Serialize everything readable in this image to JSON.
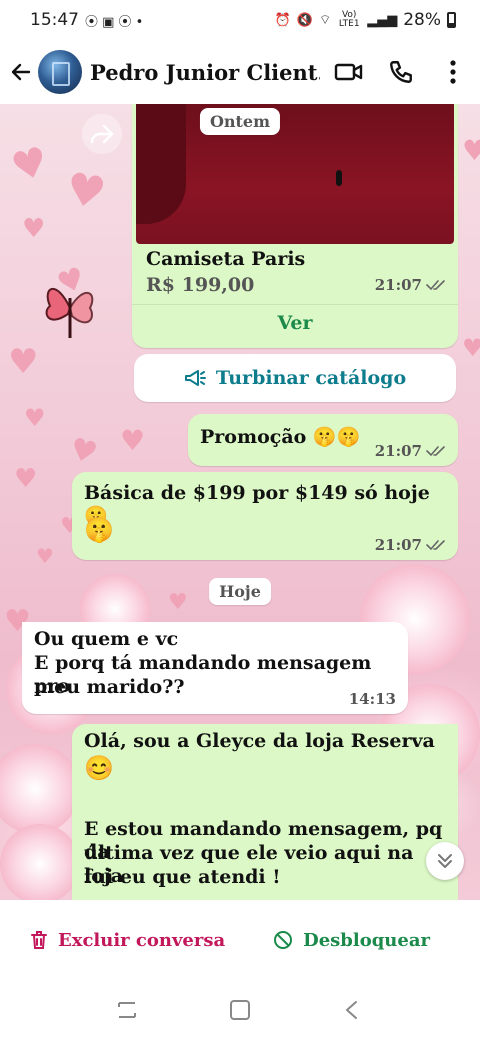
{
  "status_bar": {
    "time": "15:47",
    "battery": "28%",
    "network": "Vo) LTE1"
  },
  "header": {
    "contact_name": "Pedro Junior Client..."
  },
  "messages": [
    {
      "product_name": "Camiseta Paris",
      "product_price": "R$ 199,00",
      "time": "21:07",
      "link_label": "Ver"
    },
    {
      "catalog_label": "Turbinar catálogo"
    },
    {
      "text": "Promoção 🤫🤫",
      "time": "21:07"
    },
    {
      "text": "Básica de $199 por $149 só hoje 🤫",
      "text2": "🤫",
      "time": "21:07"
    },
    {
      "text": "Ou quem e vc",
      "text2": "E porq tá mandando mensagem pro",
      "text3": "meu marido??",
      "time": "14:13"
    },
    {
      "text": "Olá,  sou a Gleyce da loja Reserva",
      "text2": "😊",
      "text3": "E estou mandando mensagem, pq da",
      "text4": "última vez que ele veio aqui na loja",
      "text5": "fui eu que atendi !"
    }
  ],
  "dates": {
    "yesterday": "Ontem",
    "today": "Hoje"
  },
  "actions": {
    "delete_label": "Excluir conversa",
    "unblock_label": "Desbloquear"
  },
  "colors": {
    "outgoing_bubble": "#dcf8c6",
    "delete_red": "#c2185b",
    "unblock_green": "#1b8a4b",
    "link_green": "#1b8a4b",
    "catalog_teal": "#0d7c8c"
  }
}
